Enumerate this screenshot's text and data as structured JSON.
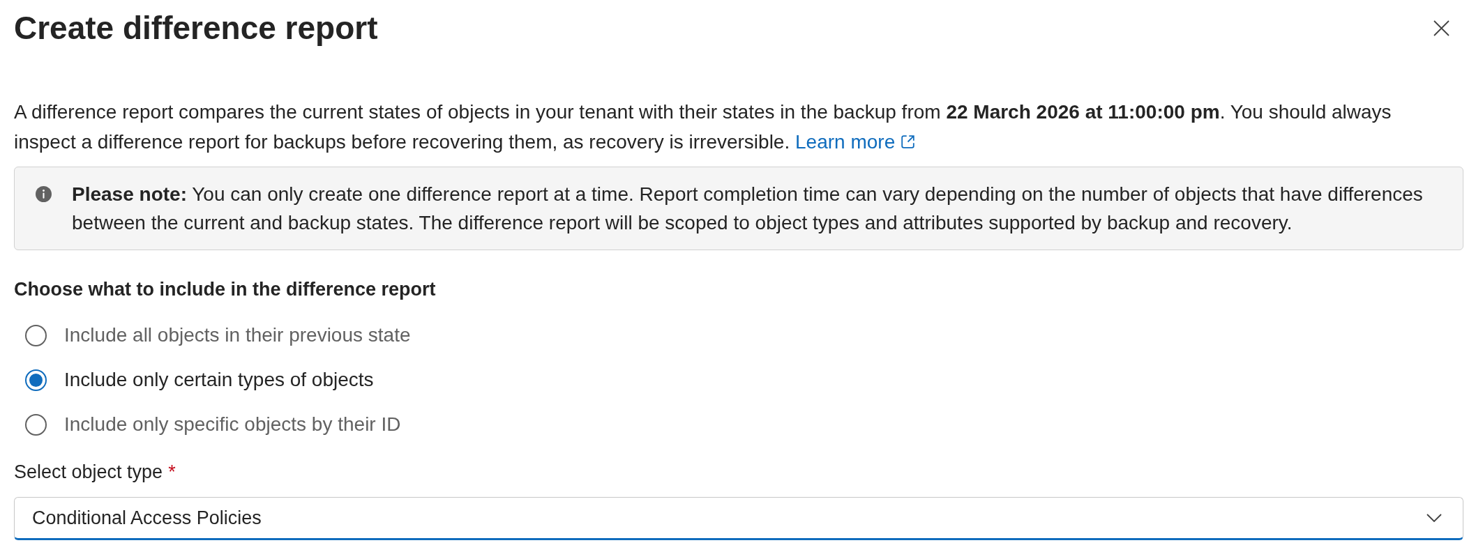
{
  "dialog": {
    "title": "Create difference report"
  },
  "intro": {
    "text": "A difference report compares the current states of objects in your tenant with their states in the backup from **22 March 2026 at 11:00:00 pm**. You should always inspect a difference report for backups before recovering them, as recovery is irreversible.",
    "link": "Learn more"
  },
  "note": {
    "text": "**Please note:** You can only create one difference report at a time. Report completion time can vary depending on the number of objects that have differences between the current and backup states. The difference report will be scoped to object types and attributes supported by backup and recovery."
  },
  "include": {
    "heading": "Choose what to include in the difference report",
    "options": [
      {
        "label": "Include all objects in their previous state",
        "selected": false
      },
      {
        "label": "Include only certain types of objects",
        "selected": true
      },
      {
        "label": "Include only specific objects by their ID",
        "selected": false
      }
    ]
  },
  "object_type": {
    "label": "Select object type",
    "required_mark": "*",
    "value": "Conditional Access Policies",
    "focused": true
  }
}
